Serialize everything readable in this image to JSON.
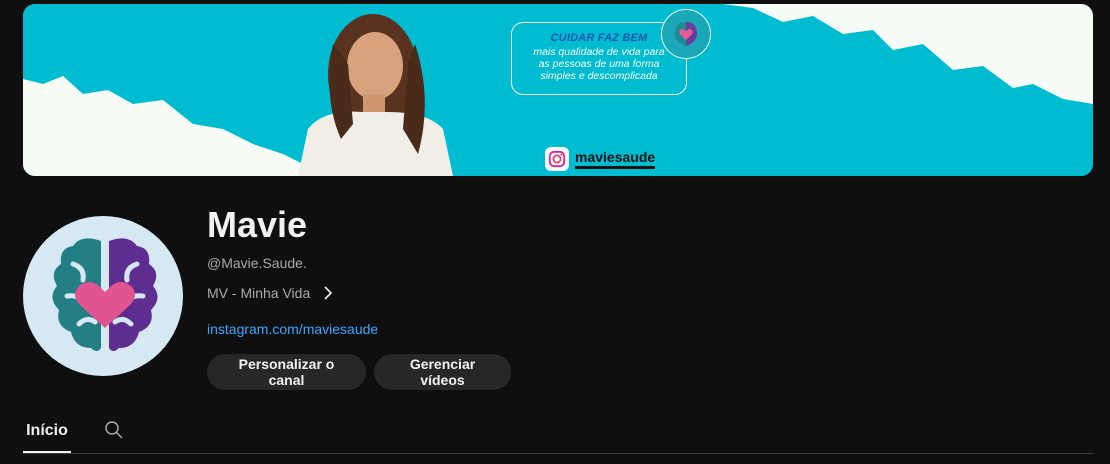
{
  "banner": {
    "tagline_title": "CUIDAR FAZ BEM",
    "tagline_line1": "mais qualidade de vida para",
    "tagline_line2": "as pessoas de uma forma",
    "tagline_line3": "simples e descomplicada",
    "instagram_handle": "maviesaude"
  },
  "channel": {
    "name": "Mavie",
    "handle": "@Mavie.Saude.",
    "more_about": "MV - Minha Vida",
    "link": "instagram.com/maviesaude"
  },
  "actions": {
    "customize_label": "Personalizar o canal",
    "manage_label": "Gerenciar vídeos"
  },
  "tabs": {
    "home_label": "Início"
  },
  "colors": {
    "background": "#0f0f0f",
    "banner_teal": "#00bcd0",
    "link_blue": "#3ea6ff",
    "button_bg": "#272727"
  },
  "icons": {
    "chevron": "chevron-right-icon",
    "search": "search-icon",
    "instagram": "instagram-icon"
  }
}
